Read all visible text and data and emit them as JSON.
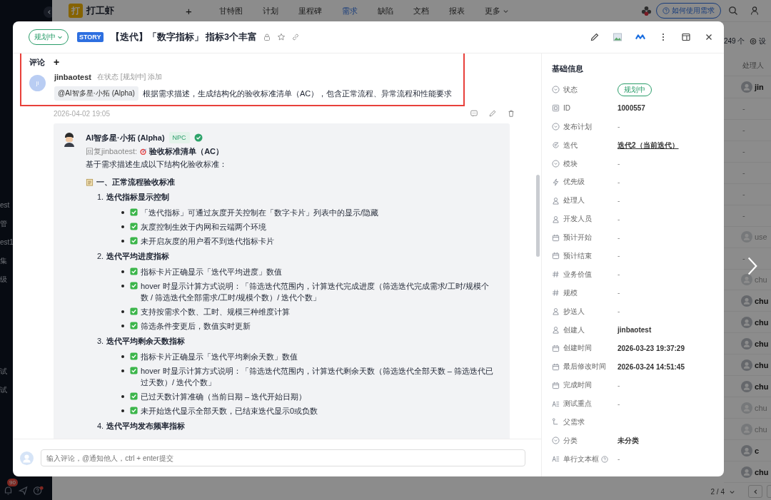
{
  "top_nav": {
    "logo": "打",
    "app_name": "打工虾",
    "add": "+",
    "items": [
      {
        "label": "甘特图",
        "selected": false
      },
      {
        "label": "计划",
        "selected": false
      },
      {
        "label": "里程碑",
        "selected": false
      },
      {
        "label": "需求",
        "selected": true
      },
      {
        "label": "缺陷",
        "selected": false
      },
      {
        "label": "文档",
        "selected": false
      },
      {
        "label": "报表",
        "selected": false
      },
      {
        "label": "更多",
        "selected": false
      }
    ],
    "help_button": "如何使用需求"
  },
  "sidebar": {
    "groups": [
      [
        "est",
        "管",
        "est1",
        "集",
        "级"
      ],
      [
        "试",
        "试"
      ]
    ],
    "notification_count": "90"
  },
  "list_view": {
    "count": "249 个",
    "settings": "设",
    "column_header": "处理人",
    "rows": [
      {
        "kind": "user",
        "name": "jin",
        "muted": false
      },
      {
        "kind": "empty",
        "name": "-"
      },
      {
        "kind": "empty",
        "name": "-"
      },
      {
        "kind": "empty",
        "name": "-"
      },
      {
        "kind": "empty",
        "name": "-"
      },
      {
        "kind": "empty",
        "name": "-"
      },
      {
        "kind": "empty",
        "name": "-"
      },
      {
        "kind": "user",
        "name": "use",
        "muted": true
      },
      {
        "kind": "empty",
        "name": "-"
      },
      {
        "kind": "user",
        "name": "chu",
        "muted": true
      },
      {
        "kind": "user",
        "name": "chu",
        "muted": false
      },
      {
        "kind": "user",
        "name": "chu",
        "muted": false
      },
      {
        "kind": "user",
        "name": "chu",
        "muted": false
      },
      {
        "kind": "user",
        "name": "chu",
        "muted": false
      },
      {
        "kind": "user",
        "name": "chu",
        "muted": false
      },
      {
        "kind": "user",
        "name": "chu",
        "muted": true
      },
      {
        "kind": "user",
        "name": "chu",
        "muted": true
      },
      {
        "kind": "user",
        "name": "c",
        "muted": false
      },
      {
        "kind": "user",
        "name": "chu",
        "muted": false
      }
    ],
    "pagination": "2 / 4"
  },
  "modal": {
    "status": "规划中",
    "type_badge": "STORY",
    "title": "【迭代】「数字指标」 指标3个丰富",
    "comments": {
      "heading": "评论",
      "add": "+",
      "comment": {
        "avatar": "ji",
        "author": "jinbaotest",
        "meta": "在状态 [规划中] 添加",
        "mention": "@AI智多星·小拓 (Alpha)",
        "text": "根据需求描述，生成结构化的验收标准清单（AC），包含正常流程、异常流程和性能要求",
        "time": "2026-04-02 19:05"
      },
      "reply": {
        "author": "AI智多星·小拓 (Alpha)",
        "badge": "NPC",
        "reply_to": "回复jinbaotest:",
        "reply_title": "验收标准清单（AC）",
        "intro": "基于需求描述生成以下结构化验收标准：",
        "section": "一、正常流程验收标准",
        "groups": [
          {
            "number": "1.",
            "title": "迭代指标显示控制",
            "items": [
              "「迭代指标」可通过灰度开关控制在「数字卡片」列表中的显示/隐藏",
              "灰度控制生效于内网和云端两个环境",
              "未开启灰度的用户看不到迭代指标卡片"
            ]
          },
          {
            "number": "2.",
            "title": "迭代平均进度指标",
            "items": [
              "指标卡片正确显示「迭代平均进度」数值",
              "hover 时显示计算方式说明：「筛选迭代范围内，计算迭代完成进度（筛选迭代完成需求/工时/规模个数 / 筛选迭代全部需求/工时/规模个数）/ 迭代个数」",
              "支持按需求个数、工时、规模三种维度计算",
              "筛选条件变更后，数值实时更新"
            ]
          },
          {
            "number": "3.",
            "title": "迭代平均剩余天数指标",
            "items": [
              "指标卡片正确显示「迭代平均剩余天数」数值",
              "hover 时显示计算方式说明：「筛选迭代范围内，计算迭代剩余天数（筛选迭代全部天数 – 筛选迭代已过天数）/ 迭代个数」",
              "已过天数计算准确（当前日期 – 迭代开始日期）",
              "未开始迭代显示全部天数，已结束迭代显示0或负数"
            ]
          },
          {
            "number": "4.",
            "title": "迭代平均发布频率指标"
          }
        ]
      }
    },
    "input_placeholder": "输入评论，@通知他人，ctrl + enter提交",
    "info": {
      "heading": "基础信息",
      "fields": [
        {
          "label": "状态",
          "kind": "pill",
          "value": "规划中"
        },
        {
          "label": "ID",
          "kind": "text",
          "value": "1000557"
        },
        {
          "label": "发布计划",
          "kind": "empty",
          "value": "-"
        },
        {
          "label": "迭代",
          "kind": "link",
          "value": "迭代2（当前迭代）"
        },
        {
          "label": "模块",
          "kind": "empty",
          "value": "-"
        },
        {
          "label": "优先级",
          "kind": "empty",
          "value": "-"
        },
        {
          "label": "处理人",
          "kind": "empty",
          "value": "-"
        },
        {
          "label": "开发人员",
          "kind": "empty",
          "value": "-"
        },
        {
          "label": "预计开始",
          "kind": "empty",
          "value": "-"
        },
        {
          "label": "预计结束",
          "kind": "empty",
          "value": "-"
        },
        {
          "label": "业务价值",
          "kind": "empty",
          "value": "-"
        },
        {
          "label": "规模",
          "kind": "empty",
          "value": "-"
        },
        {
          "label": "抄送人",
          "kind": "empty",
          "value": "-"
        },
        {
          "label": "创建人",
          "kind": "text",
          "value": "jinbaotest"
        },
        {
          "label": "创建时间",
          "kind": "text",
          "value": "2026-03-23 19:37:29"
        },
        {
          "label": "最后修改时间",
          "kind": "text",
          "value": "2026-03-24 14:51:45"
        },
        {
          "label": "完成时间",
          "kind": "empty",
          "value": "-"
        },
        {
          "label": "测试重点",
          "kind": "empty",
          "value": "-"
        },
        {
          "label": "父需求",
          "kind": "none"
        },
        {
          "label": "分类",
          "kind": "text",
          "value": "未分类"
        },
        {
          "label": "单行文本框",
          "kind": "empty",
          "value": "-",
          "help": true
        }
      ]
    }
  }
}
